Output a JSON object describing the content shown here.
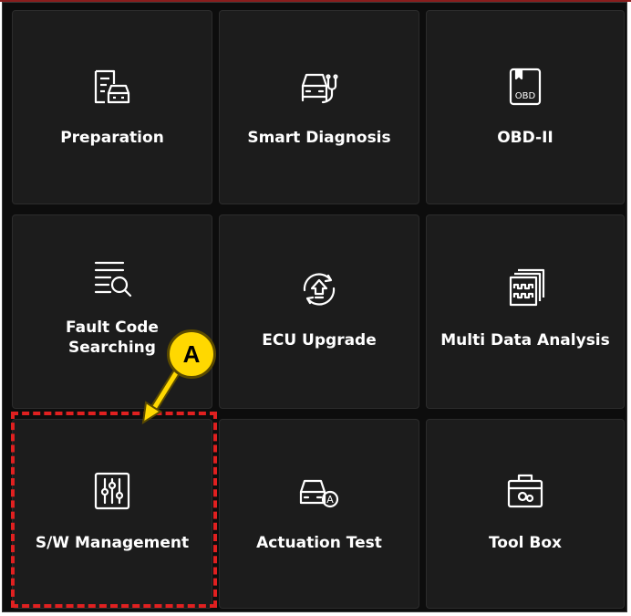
{
  "menu": {
    "tiles": [
      {
        "label": "Preparation",
        "icon": "document-car-icon"
      },
      {
        "label": "Smart Diagnosis",
        "icon": "car-stethoscope-icon"
      },
      {
        "label": "OBD-II",
        "icon": "obd-book-icon",
        "icon_text": "OBD"
      },
      {
        "label": "Fault Code\nSearching",
        "icon": "list-search-icon"
      },
      {
        "label": "ECU Upgrade",
        "icon": "upgrade-cycle-icon"
      },
      {
        "label": "Multi Data Analysis",
        "icon": "waveform-stack-icon"
      },
      {
        "label": "S/W Management",
        "icon": "sliders-icon"
      },
      {
        "label": "Actuation Test",
        "icon": "car-actuation-icon",
        "icon_text": "A"
      },
      {
        "label": "Tool Box",
        "icon": "toolbox-icon"
      }
    ]
  },
  "annotation": {
    "callout_label": "A",
    "highlight_color": "#e02020",
    "callout_color": "#ffd800"
  },
  "colors": {
    "background": "#0d0d0d",
    "tile": "#1c1c1c",
    "text": "#ffffff"
  }
}
